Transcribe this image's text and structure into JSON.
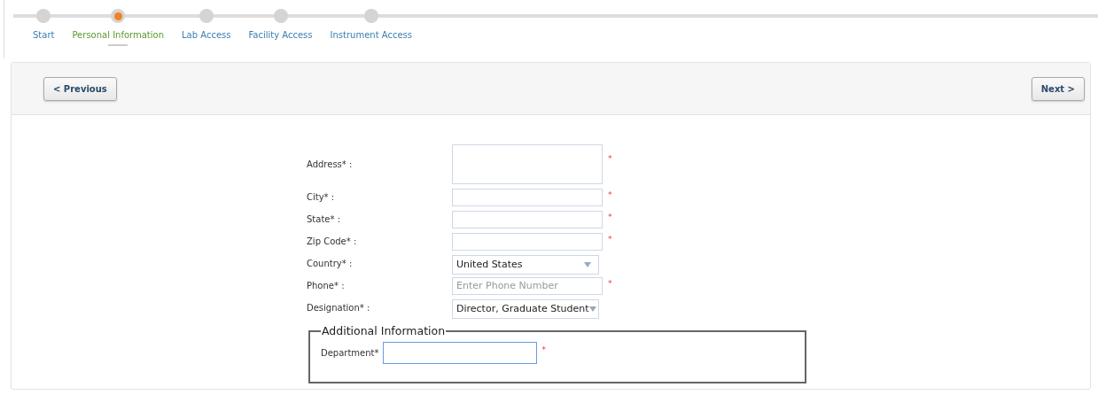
{
  "steps": [
    {
      "label": "Start",
      "selected": false
    },
    {
      "label": "Personal Information",
      "selected": true
    },
    {
      "label": "Lab Access",
      "selected": false
    },
    {
      "label": "Facility Access",
      "selected": false
    },
    {
      "label": "Instrument Access",
      "selected": false
    }
  ],
  "toolbar": {
    "previous": "< Previous",
    "next": "Next >"
  },
  "fields": [
    {
      "kind": "textarea",
      "label": "Address* :",
      "required_mark": "*"
    },
    {
      "kind": "text",
      "label": "City* :",
      "required_mark": "*"
    },
    {
      "kind": "text",
      "label": "State* :",
      "required_mark": "*"
    },
    {
      "kind": "text",
      "label": "Zip Code* :",
      "required_mark": "*"
    },
    {
      "kind": "select",
      "label": "Country* :",
      "value": "United States"
    },
    {
      "kind": "text",
      "label": "Phone* :",
      "placeholder": "Enter Phone Number",
      "required_mark": "*"
    },
    {
      "kind": "select",
      "label": "Designation* :",
      "value": "Director, Graduate Student"
    }
  ],
  "additional_information": {
    "legend": "Additional Information",
    "fields": [
      {
        "kind": "text",
        "label": "Department*",
        "required_mark": "*",
        "focused": true
      }
    ]
  }
}
